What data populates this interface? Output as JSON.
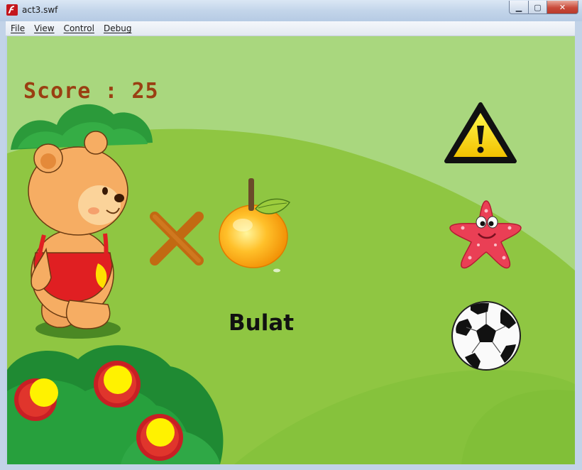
{
  "window": {
    "title": "act3.swf",
    "app_icon": "flash-player-icon",
    "buttons": {
      "minimize": "minimize-icon",
      "maximize": "maximize-icon",
      "close": "close-icon"
    }
  },
  "menu": [
    "File",
    "View",
    "Control",
    "Debug"
  ],
  "game": {
    "score_label": "Score : 25",
    "word": "Bulat",
    "target_object": "orange",
    "choices": [
      "warning-sign",
      "starfish",
      "soccer-ball"
    ],
    "answer_mark": "wrong"
  },
  "colors": {
    "sky": "#a7d67c",
    "hill": "#8cc63f",
    "score": "#9a3f12",
    "flower_petal": "#d6262a",
    "flower_center": "#fff200"
  }
}
